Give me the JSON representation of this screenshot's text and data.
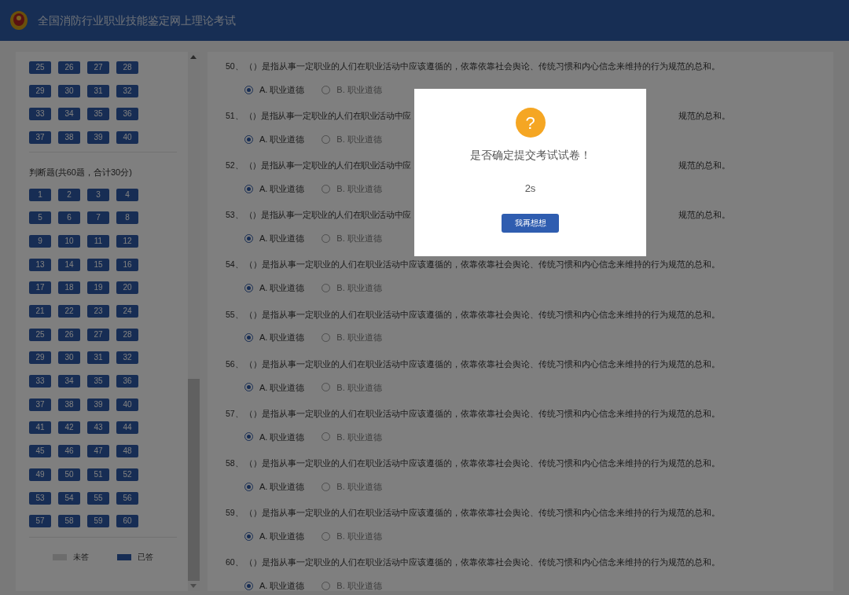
{
  "header": {
    "title": "全国消防行业职业技能鉴定网上理论考试"
  },
  "sidebar": {
    "groups": [
      {
        "items": [
          {
            "label": "25",
            "answered": true
          },
          {
            "label": "26",
            "answered": true
          },
          {
            "label": "27",
            "answered": true
          },
          {
            "label": "28",
            "answered": true
          },
          {
            "label": "29",
            "answered": true
          },
          {
            "label": "30",
            "answered": true
          },
          {
            "label": "31",
            "answered": true
          },
          {
            "label": "32",
            "answered": true
          },
          {
            "label": "33",
            "answered": true
          },
          {
            "label": "34",
            "answered": true
          },
          {
            "label": "35",
            "answered": true
          },
          {
            "label": "36",
            "answered": true
          },
          {
            "label": "37",
            "answered": true
          },
          {
            "label": "38",
            "answered": true
          },
          {
            "label": "39",
            "answered": true
          },
          {
            "label": "40",
            "answered": true
          }
        ]
      },
      {
        "title": "判断题(共60题，合计30分)",
        "items": [
          {
            "label": "1",
            "answered": true
          },
          {
            "label": "2",
            "answered": true
          },
          {
            "label": "3",
            "answered": true
          },
          {
            "label": "4",
            "answered": true
          },
          {
            "label": "5",
            "answered": true
          },
          {
            "label": "6",
            "answered": true
          },
          {
            "label": "7",
            "answered": true
          },
          {
            "label": "8",
            "answered": true
          },
          {
            "label": "9",
            "answered": true
          },
          {
            "label": "10",
            "answered": true
          },
          {
            "label": "11",
            "answered": true
          },
          {
            "label": "12",
            "answered": true
          },
          {
            "label": "13",
            "answered": true
          },
          {
            "label": "14",
            "answered": true
          },
          {
            "label": "15",
            "answered": true
          },
          {
            "label": "16",
            "answered": true
          },
          {
            "label": "17",
            "answered": true
          },
          {
            "label": "18",
            "answered": true
          },
          {
            "label": "19",
            "answered": true
          },
          {
            "label": "20",
            "answered": true
          },
          {
            "label": "21",
            "answered": true
          },
          {
            "label": "22",
            "answered": true
          },
          {
            "label": "23",
            "answered": true
          },
          {
            "label": "24",
            "answered": true
          },
          {
            "label": "25",
            "answered": true
          },
          {
            "label": "26",
            "answered": true
          },
          {
            "label": "27",
            "answered": true
          },
          {
            "label": "28",
            "answered": true
          },
          {
            "label": "29",
            "answered": true
          },
          {
            "label": "30",
            "answered": true
          },
          {
            "label": "31",
            "answered": true
          },
          {
            "label": "32",
            "answered": true
          },
          {
            "label": "33",
            "answered": true
          },
          {
            "label": "34",
            "answered": true
          },
          {
            "label": "35",
            "answered": true
          },
          {
            "label": "36",
            "answered": true
          },
          {
            "label": "37",
            "answered": true
          },
          {
            "label": "38",
            "answered": true
          },
          {
            "label": "39",
            "answered": true
          },
          {
            "label": "40",
            "answered": true
          },
          {
            "label": "41",
            "answered": true
          },
          {
            "label": "42",
            "answered": true
          },
          {
            "label": "43",
            "answered": true
          },
          {
            "label": "44",
            "answered": true
          },
          {
            "label": "45",
            "answered": true
          },
          {
            "label": "46",
            "answered": true
          },
          {
            "label": "47",
            "answered": true
          },
          {
            "label": "48",
            "answered": true
          },
          {
            "label": "49",
            "answered": true
          },
          {
            "label": "50",
            "answered": true
          },
          {
            "label": "51",
            "answered": true
          },
          {
            "label": "52",
            "answered": true
          },
          {
            "label": "53",
            "answered": true
          },
          {
            "label": "54",
            "answered": true
          },
          {
            "label": "55",
            "answered": true
          },
          {
            "label": "56",
            "answered": true
          },
          {
            "label": "57",
            "answered": true
          },
          {
            "label": "58",
            "answered": true
          },
          {
            "label": "59",
            "answered": true
          },
          {
            "label": "60",
            "answered": true
          }
        ]
      }
    ],
    "legend": [
      {
        "label": "未答",
        "answered": false
      },
      {
        "label": "已答",
        "answered": true
      }
    ]
  },
  "questions": [
    {
      "number": "50、",
      "text": "（）是指从事一定职业的人们在职业活动中应该遵循的，依靠依靠社会舆论、传统习惯和内心信念来维持的行为规范的总和。",
      "options": [
        {
          "label": "A. 职业道德",
          "selected": true
        },
        {
          "label": "B. 职业道德",
          "selected": false
        }
      ]
    },
    {
      "number": "51、",
      "text": "（）是指从事一定职业的人们在职业活动中应",
      "text_after": "规范的总和。",
      "options": [
        {
          "label": "A. 职业道德",
          "selected": true
        },
        {
          "label": "B. 职业道德",
          "selected": false
        }
      ]
    },
    {
      "number": "52、",
      "text": "（）是指从事一定职业的人们在职业活动中应",
      "text_after": "规范的总和。",
      "options": [
        {
          "label": "A. 职业道德",
          "selected": true
        },
        {
          "label": "B. 职业道德",
          "selected": false
        }
      ]
    },
    {
      "number": "53、",
      "text": "（）是指从事一定职业的人们在职业活动中应",
      "text_after": "规范的总和。",
      "options": [
        {
          "label": "A. 职业道德",
          "selected": true
        },
        {
          "label": "B. 职业道德",
          "selected": false
        }
      ]
    },
    {
      "number": "54、",
      "text": "（）是指从事一定职业的人们在职业活动中应该遵循的，依靠依靠社会舆论、传统习惯和内心信念来维持的行为规范的总和。",
      "options": [
        {
          "label": "A. 职业道德",
          "selected": true
        },
        {
          "label": "B. 职业道德",
          "selected": false
        }
      ]
    },
    {
      "number": "55、",
      "text": "（）是指从事一定职业的人们在职业活动中应该遵循的，依靠依靠社会舆论、传统习惯和内心信念来维持的行为规范的总和。",
      "options": [
        {
          "label": "A. 职业道德",
          "selected": true
        },
        {
          "label": "B. 职业道德",
          "selected": false
        }
      ]
    },
    {
      "number": "56、",
      "text": "（）是指从事一定职业的人们在职业活动中应该遵循的，依靠依靠社会舆论、传统习惯和内心信念来维持的行为规范的总和。",
      "options": [
        {
          "label": "A. 职业道德",
          "selected": true
        },
        {
          "label": "B. 职业道德",
          "selected": false
        }
      ]
    },
    {
      "number": "57、",
      "text": "（）是指从事一定职业的人们在职业活动中应该遵循的，依靠依靠社会舆论、传统习惯和内心信念来维持的行为规范的总和。",
      "options": [
        {
          "label": "A. 职业道德",
          "selected": true
        },
        {
          "label": "B. 职业道德",
          "selected": false
        }
      ]
    },
    {
      "number": "58、",
      "text": "（）是指从事一定职业的人们在职业活动中应该遵循的，依靠依靠社会舆论、传统习惯和内心信念来维持的行为规范的总和。",
      "options": [
        {
          "label": "A. 职业道德",
          "selected": true
        },
        {
          "label": "B. 职业道德",
          "selected": false
        }
      ]
    },
    {
      "number": "59、",
      "text": "（）是指从事一定职业的人们在职业活动中应该遵循的，依靠依靠社会舆论、传统习惯和内心信念来维持的行为规范的总和。",
      "options": [
        {
          "label": "A. 职业道德",
          "selected": true
        },
        {
          "label": "B. 职业道德",
          "selected": false
        }
      ]
    },
    {
      "number": "60、",
      "text": "（）是指从事一定职业的人们在职业活动中应该遵循的，依靠依靠社会舆论、传统习惯和内心信念来维持的行为规范的总和。",
      "options": [
        {
          "label": "A. 职业道德",
          "selected": true
        },
        {
          "label": "B. 职业道德",
          "selected": false
        }
      ]
    }
  ],
  "dialog": {
    "icon_text": "?",
    "message": "是否确定提交考试试卷！",
    "countdown": "2s",
    "button": "我再想想"
  }
}
